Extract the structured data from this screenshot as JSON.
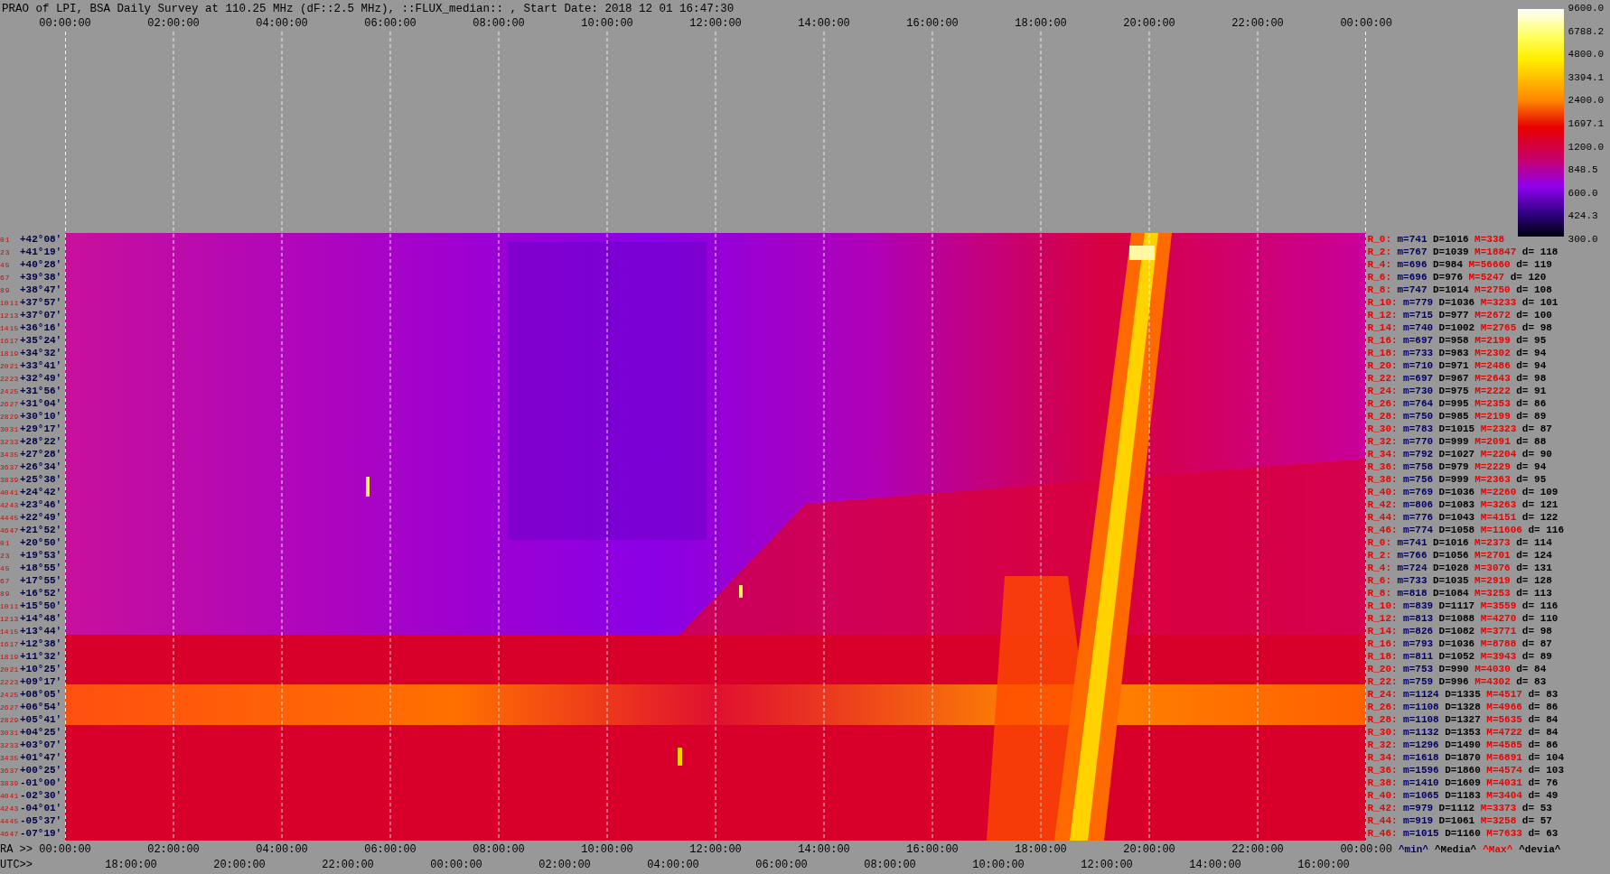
{
  "title": "PRAO of LPI, BSA Daily Survey at 110.25 MHz (dF::2.5 MHz), ::FLUX_median:: , Start Date: 2018 12 01 16:47:30",
  "top_ticks": [
    "00:00:00",
    "02:00:00",
    "04:00:00",
    "06:00:00",
    "08:00:00",
    "10:00:00",
    "12:00:00",
    "14:00:00",
    "16:00:00",
    "18:00:00",
    "20:00:00",
    "22:00:00",
    "00:00:00"
  ],
  "colorbar": {
    "ticks": [
      "9600.0",
      "6788.2",
      "4800.0",
      "3394.1",
      "2400.0",
      "1697.1",
      "1200.0",
      "848.5",
      "600.0",
      "424.3",
      "300.0"
    ]
  },
  "declinations": [
    {
      "numbers": [
        "0",
        "1"
      ],
      "dec": "+42°08′"
    },
    {
      "numbers": [
        "2",
        "3"
      ],
      "dec": "+41°19′"
    },
    {
      "numbers": [
        "4",
        "5"
      ],
      "dec": "+40°28′"
    },
    {
      "numbers": [
        "6",
        "7"
      ],
      "dec": "+39°38′"
    },
    {
      "numbers": [
        "8",
        "9"
      ],
      "dec": "+38°47′"
    },
    {
      "numbers": [
        "10",
        "11"
      ],
      "dec": "+37°57′"
    },
    {
      "numbers": [
        "12",
        "13"
      ],
      "dec": "+37°07′"
    },
    {
      "numbers": [
        "14",
        "15"
      ],
      "dec": "+36°16′"
    },
    {
      "numbers": [
        "16",
        "17"
      ],
      "dec": "+35°24′"
    },
    {
      "numbers": [
        "18",
        "19"
      ],
      "dec": "+34°32′"
    },
    {
      "numbers": [
        "20",
        "21"
      ],
      "dec": "+33°41′"
    },
    {
      "numbers": [
        "22",
        "23"
      ],
      "dec": "+32°49′"
    },
    {
      "numbers": [
        "24",
        "25"
      ],
      "dec": "+31°56′"
    },
    {
      "numbers": [
        "26",
        "27"
      ],
      "dec": "+31°04′"
    },
    {
      "numbers": [
        "28",
        "29"
      ],
      "dec": "+30°10′"
    },
    {
      "numbers": [
        "30",
        "31"
      ],
      "dec": "+29°17′"
    },
    {
      "numbers": [
        "32",
        "33"
      ],
      "dec": "+28°22′"
    },
    {
      "numbers": [
        "34",
        "35"
      ],
      "dec": "+27°28′"
    },
    {
      "numbers": [
        "36",
        "37"
      ],
      "dec": "+26°34′"
    },
    {
      "numbers": [
        "38",
        "39"
      ],
      "dec": "+25°38′"
    },
    {
      "numbers": [
        "40",
        "41"
      ],
      "dec": "+24°42′"
    },
    {
      "numbers": [
        "42",
        "43"
      ],
      "dec": "+23°46′"
    },
    {
      "numbers": [
        "44",
        "45"
      ],
      "dec": "+22°49′"
    },
    {
      "numbers": [
        "46",
        "47"
      ],
      "dec": "+21°52′"
    },
    {
      "numbers": [
        "0",
        "1"
      ],
      "dec": "+20°50′"
    },
    {
      "numbers": [
        "2",
        "3"
      ],
      "dec": "+19°53′"
    },
    {
      "numbers": [
        "4",
        "5"
      ],
      "dec": "+18°55′"
    },
    {
      "numbers": [
        "6",
        "7"
      ],
      "dec": "+17°55′"
    },
    {
      "numbers": [
        "8",
        "9"
      ],
      "dec": "+16°52′"
    },
    {
      "numbers": [
        "10",
        "11"
      ],
      "dec": "+15°50′"
    },
    {
      "numbers": [
        "12",
        "13"
      ],
      "dec": "+14°48′"
    },
    {
      "numbers": [
        "14",
        "15"
      ],
      "dec": "+13°44′"
    },
    {
      "numbers": [
        "16",
        "17"
      ],
      "dec": "+12°38′"
    },
    {
      "numbers": [
        "18",
        "19"
      ],
      "dec": "+11°32′"
    },
    {
      "numbers": [
        "20",
        "21"
      ],
      "dec": "+10°25′"
    },
    {
      "numbers": [
        "22",
        "23"
      ],
      "dec": "+09°17′"
    },
    {
      "numbers": [
        "24",
        "25"
      ],
      "dec": "+08°05′"
    },
    {
      "numbers": [
        "26",
        "27"
      ],
      "dec": "+06°54′"
    },
    {
      "numbers": [
        "28",
        "29"
      ],
      "dec": "+05°41′"
    },
    {
      "numbers": [
        "30",
        "31"
      ],
      "dec": "+04°25′"
    },
    {
      "numbers": [
        "32",
        "33"
      ],
      "dec": "+03°07′"
    },
    {
      "numbers": [
        "34",
        "35"
      ],
      "dec": "+01°47′"
    },
    {
      "numbers": [
        "36",
        "37"
      ],
      "dec": "+00°25′"
    },
    {
      "numbers": [
        "38",
        "39"
      ],
      "dec": "-01°00′"
    },
    {
      "numbers": [
        "40",
        "41"
      ],
      "dec": "-02°30′"
    },
    {
      "numbers": [
        "42",
        "43"
      ],
      "dec": "-04°01′"
    },
    {
      "numbers": [
        "44",
        "45"
      ],
      "dec": "-05°37′"
    },
    {
      "numbers": [
        "46",
        "47"
      ],
      "dec": "-07°19′"
    }
  ],
  "stats": [
    {
      "row": "R_0:",
      "min": "m=741",
      "median": "D=1016",
      "max": "M=338"
    },
    {
      "row": "R_2:",
      "min": "m=767",
      "median": "D=1039",
      "max": "M=18847",
      "dev": "d= 118"
    },
    {
      "row": "R_4:",
      "min": "m=696",
      "median": "D=984",
      "max": "M=56660",
      "dev": "d= 119"
    },
    {
      "row": "R_6:",
      "min": "m=696",
      "median": "D=976",
      "max": "M=5247",
      "dev": "d= 120"
    },
    {
      "row": "R_8:",
      "min": "m=747",
      "median": "D=1014",
      "max": "M=2750",
      "dev": "d= 108"
    },
    {
      "row": "R_10:",
      "min": "m=779",
      "median": "D=1036",
      "max": "M=3233",
      "dev": "d= 101"
    },
    {
      "row": "R_12:",
      "min": "m=715",
      "median": "D=977",
      "max": "M=2672",
      "dev": "d= 100"
    },
    {
      "row": "R_14:",
      "min": "m=740",
      "median": "D=1002",
      "max": "M=2765",
      "dev": "d= 98"
    },
    {
      "row": "R_16:",
      "min": "m=697",
      "median": "D=958",
      "max": "M=2199",
      "dev": "d= 95"
    },
    {
      "row": "R_18:",
      "min": "m=733",
      "median": "D=983",
      "max": "M=2302",
      "dev": "d= 94"
    },
    {
      "row": "R_20:",
      "min": "m=710",
      "median": "D=971",
      "max": "M=2486",
      "dev": "d= 94"
    },
    {
      "row": "R_22:",
      "min": "m=697",
      "median": "D=967",
      "max": "M=2643",
      "dev": "d= 98"
    },
    {
      "row": "R_24:",
      "min": "m=730",
      "median": "D=975",
      "max": "M=2222",
      "dev": "d= 91"
    },
    {
      "row": "R_26:",
      "min": "m=764",
      "median": "D=995",
      "max": "M=2353",
      "dev": "d= 86"
    },
    {
      "row": "R_28:",
      "min": "m=750",
      "median": "D=985",
      "max": "M=2199",
      "dev": "d= 89"
    },
    {
      "row": "R_30:",
      "min": "m=783",
      "median": "D=1015",
      "max": "M=2323",
      "dev": "d= 87"
    },
    {
      "row": "R_32:",
      "min": "m=770",
      "median": "D=999",
      "max": "M=2091",
      "dev": "d= 88"
    },
    {
      "row": "R_34:",
      "min": "m=792",
      "median": "D=1027",
      "max": "M=2204",
      "dev": "d= 90"
    },
    {
      "row": "R_36:",
      "min": "m=758",
      "median": "D=979",
      "max": "M=2229",
      "dev": "d= 94"
    },
    {
      "row": "R_38:",
      "min": "m=756",
      "median": "D=999",
      "max": "M=2363",
      "dev": "d= 95"
    },
    {
      "row": "R_40:",
      "min": "m=769",
      "median": "D=1036",
      "max": "M=2260",
      "dev": "d= 109"
    },
    {
      "row": "R_42:",
      "min": "m=806",
      "median": "D=1083",
      "max": "M=3263",
      "dev": "d= 121"
    },
    {
      "row": "R_44:",
      "min": "m=776",
      "median": "D=1043",
      "max": "M=4151",
      "dev": "d= 122"
    },
    {
      "row": "R_46:",
      "min": "m=774",
      "median": "D=1058",
      "max": "M=11606",
      "dev": "d= 116"
    },
    {
      "row": "R_0:",
      "min": "m=741",
      "median": "D=1016",
      "max": "M=2373",
      "dev": "d= 114"
    },
    {
      "row": "R_2:",
      "min": "m=766",
      "median": "D=1056",
      "max": "M=2701",
      "dev": "d= 124"
    },
    {
      "row": "R_4:",
      "min": "m=724",
      "median": "D=1028",
      "max": "M=3076",
      "dev": "d= 131"
    },
    {
      "row": "R_6:",
      "min": "m=733",
      "median": "D=1035",
      "max": "M=2919",
      "dev": "d= 128"
    },
    {
      "row": "R_8:",
      "min": "m=818",
      "median": "D=1084",
      "max": "M=3253",
      "dev": "d= 113"
    },
    {
      "row": "R_10:",
      "min": "m=839",
      "median": "D=1117",
      "max": "M=3559",
      "dev": "d= 116"
    },
    {
      "row": "R_12:",
      "min": "m=813",
      "median": "D=1088",
      "max": "M=4270",
      "dev": "d= 110"
    },
    {
      "row": "R_14:",
      "min": "m=826",
      "median": "D=1082",
      "max": "M=3771",
      "dev": "d= 98"
    },
    {
      "row": "R_16:",
      "min": "m=793",
      "median": "D=1036",
      "max": "M=8788",
      "dev": "d= 87"
    },
    {
      "row": "R_18:",
      "min": "m=811",
      "median": "D=1052",
      "max": "M=3943",
      "dev": "d= 89"
    },
    {
      "row": "R_20:",
      "min": "m=753",
      "median": "D=990",
      "max": "M=4030",
      "dev": "d= 84"
    },
    {
      "row": "R_22:",
      "min": "m=759",
      "median": "D=996",
      "max": "M=4302",
      "dev": "d= 83"
    },
    {
      "row": "R_24:",
      "min": "m=1124",
      "median": "D=1335",
      "max": "M=4517",
      "dev": "d= 83"
    },
    {
      "row": "R_26:",
      "min": "m=1108",
      "median": "D=1328",
      "max": "M=4966",
      "dev": "d= 86"
    },
    {
      "row": "R_28:",
      "min": "m=1108",
      "median": "D=1327",
      "max": "M=5635",
      "dev": "d= 84"
    },
    {
      "row": "R_30:",
      "min": "m=1132",
      "median": "D=1353",
      "max": "M=4722",
      "dev": "d= 84"
    },
    {
      "row": "R_32:",
      "min": "m=1296",
      "median": "D=1490",
      "max": "M=4585",
      "dev": "d= 86"
    },
    {
      "row": "R_34:",
      "min": "m=1618",
      "median": "D=1870",
      "max": "M=6891",
      "dev": "d= 104"
    },
    {
      "row": "R_36:",
      "min": "m=1596",
      "median": "D=1860",
      "max": "M=4574",
      "dev": "d= 103"
    },
    {
      "row": "R_38:",
      "min": "m=1410",
      "median": "D=1609",
      "max": "M=4031",
      "dev": "d= 76"
    },
    {
      "row": "R_40:",
      "min": "m=1065",
      "median": "D=1183",
      "max": "M=3404",
      "dev": "d= 49"
    },
    {
      "row": "R_42:",
      "min": "m=979",
      "median": "D=1112",
      "max": "M=3373",
      "dev": "d= 53"
    },
    {
      "row": "R_44:",
      "min": "m=919",
      "median": "D=1061",
      "max": "M=3258",
      "dev": "d= 57"
    },
    {
      "row": "R_46:",
      "min": "m=1015",
      "median": "D=1160",
      "max": "M=7633",
      "dev": "d= 63"
    }
  ],
  "ra_axis": {
    "label": "RA >>",
    "ticks": [
      "00:00:00",
      "02:00:00",
      "04:00:00",
      "06:00:00",
      "08:00:00",
      "10:00:00",
      "12:00:00",
      "14:00:00",
      "16:00:00",
      "18:00:00",
      "20:00:00",
      "22:00:00",
      "00:00:00"
    ]
  },
  "legend": [
    {
      "kind": "min",
      "text": "^min^"
    },
    {
      "kind": "median",
      "text": "^Media^"
    },
    {
      "kind": "max",
      "text": "^Max^"
    },
    {
      "kind": "dev",
      "text": "^devia^"
    }
  ],
  "utc_axis": {
    "label": "UTC>>",
    "ticks": [
      "18:00:00",
      "20:00:00",
      "22:00:00",
      "00:00:00",
      "02:00:00",
      "04:00:00",
      "06:00:00",
      "08:00:00",
      "10:00:00",
      "12:00:00",
      "14:00:00",
      "16:00:00"
    ]
  }
}
